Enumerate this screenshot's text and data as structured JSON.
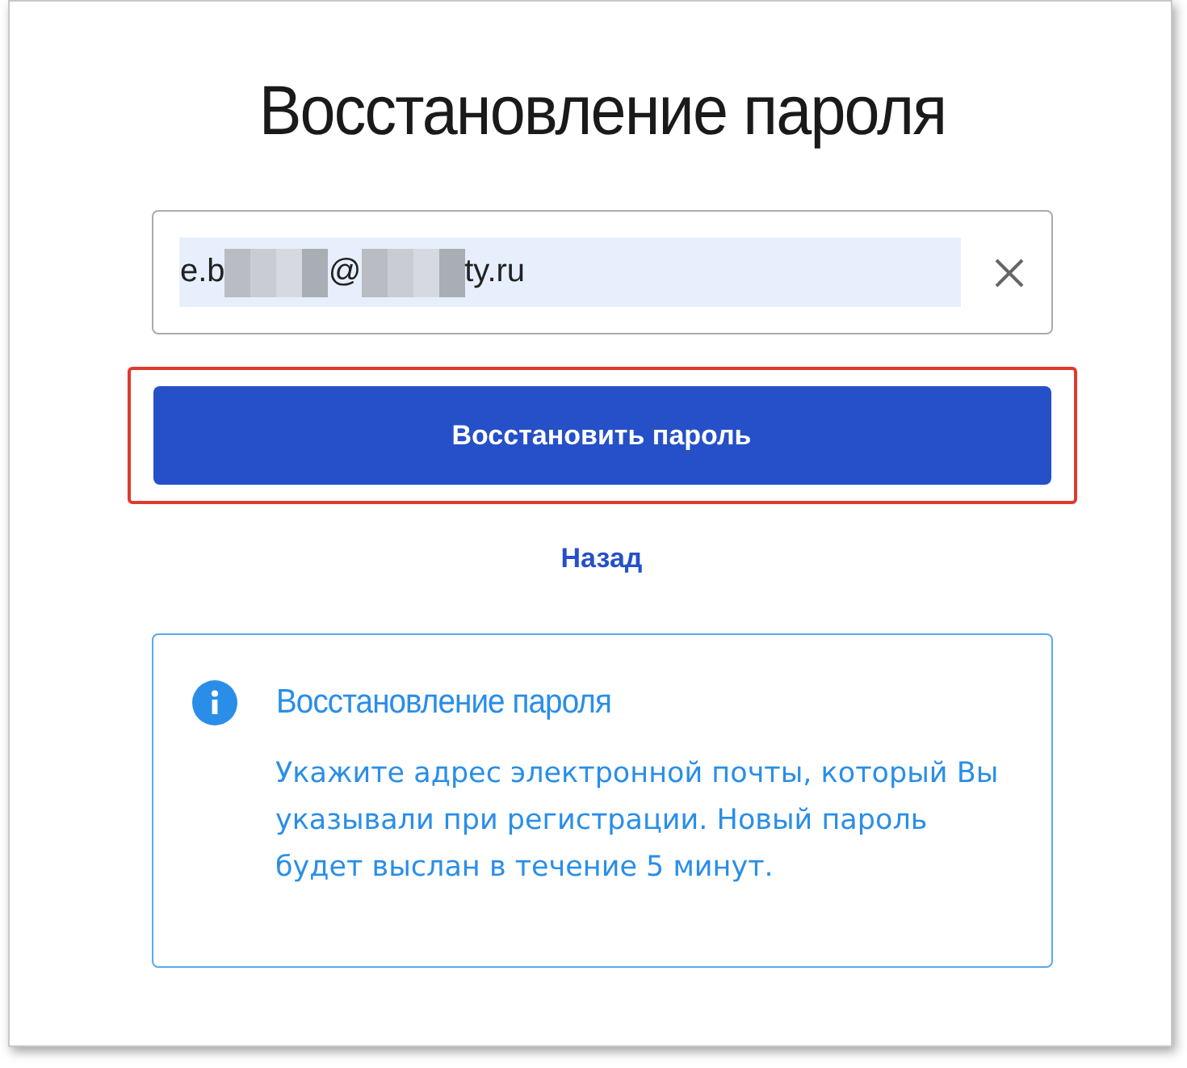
{
  "title": "Восстановление пароля",
  "email_field": {
    "autofilled": true,
    "segments": [
      {
        "kind": "text",
        "text": "e.b"
      },
      {
        "kind": "redacted"
      },
      {
        "kind": "text",
        "text": "@"
      },
      {
        "kind": "redacted"
      },
      {
        "kind": "text",
        "text": "ty.ru"
      }
    ]
  },
  "submit_button": {
    "label": "Восстановить пароль",
    "highlighted": true
  },
  "back_link": "Назад",
  "info": {
    "title": "Восстановление пароля",
    "text": "Укажите адрес электронной почты, который Вы указывали при регистрации. Новый пароль будет выслан в течение 5 минут."
  }
}
